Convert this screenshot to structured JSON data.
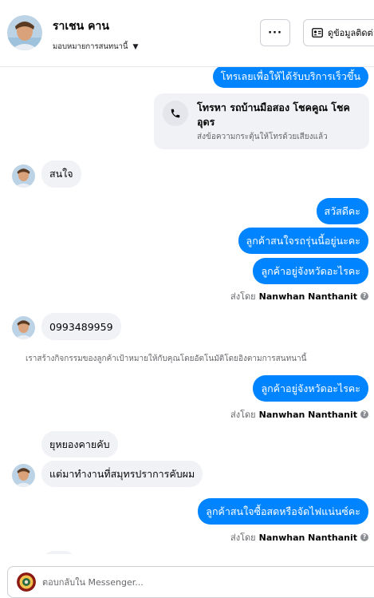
{
  "header": {
    "contact_name": "ราเชน คาน",
    "assign_label": "มอบหมายการสนทนานี้",
    "more_label": "···",
    "info_button_label": "ดูข้อมูลติดต่อ"
  },
  "messages": {
    "m1": "โทรเลยเพื่อให้ได้รับบริการเร็วขึ้น",
    "call_title": "โทรหา รถบ้านมือสอง โชคคูณ โชคอุดร",
    "call_sub": "ส่งข้อความกระตุ้นให้โทรด้วยเสียงแล้ว",
    "m2": "สนใจ",
    "m3": "สวัสดีคะ",
    "m4": "ลูกค้าสนใจรถรุ่นนี้อยู่นะคะ",
    "m5": "ลูกค้าอยู่จังหวัดอะไรคะ",
    "m6": "0993489959",
    "system_note": "เราสร้างกิจกรรมของลูกค้าเป้าหมายให้กับคุณโดยอัตโนมัติโดยอิงตามการสนทนานี้",
    "m7": "ลูกค้าอยู่จังหวัดอะไรคะ",
    "m8": "ยุหยองคายคับ",
    "m9": "แต่มาทำงานที่สมุทรปราการคับผม",
    "m10": "ลูกค้าสนใจซื้อสดหรือจัดไฟแน่นซ์คะ"
  },
  "sent_by": {
    "prefix": "ส่งโดย",
    "agent": "Nanwhan Nanthanit"
  },
  "composer": {
    "placeholder": "ตอบกลับใน Messenger..."
  },
  "colors": {
    "outgoing": "#0084ff",
    "incoming": "#f0f2f5",
    "secondary_text": "#65676b"
  },
  "icons": {
    "more": "more-icon",
    "info": "contact-card-icon",
    "phone": "phone-icon",
    "help": "help-circle-icon"
  }
}
